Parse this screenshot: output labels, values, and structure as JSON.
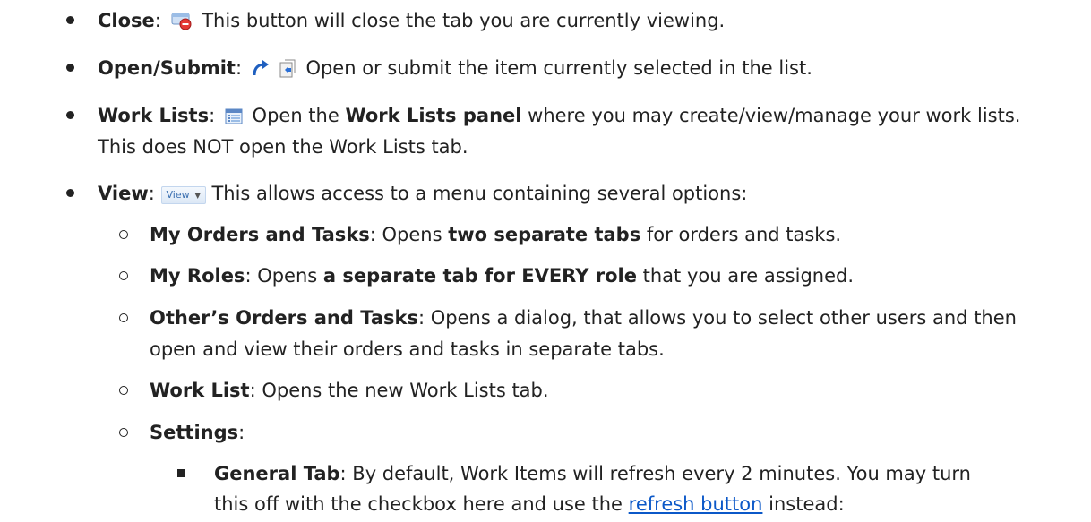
{
  "items": {
    "close": {
      "label": "Close",
      "colon": ":",
      "text": "This button will close the tab you are currently viewing.",
      "icon": "close-tab-icon"
    },
    "open_submit": {
      "label": "Open/Submit",
      "colon": ":",
      "text": "Open or submit the item currently selected in the list.",
      "icons": [
        "open-arrow-icon",
        "submit-document-icon"
      ]
    },
    "work_lists": {
      "label": "Work Lists",
      "colon": ":",
      "text_before": "Open the",
      "bold_phrase": "Work Lists panel",
      "text_after": "where you may create/view/manage your work lists.",
      "line2": "This does NOT open the Work Lists tab.",
      "icon": "work-lists-panel-icon"
    },
    "view": {
      "label": "View",
      "colon": ":",
      "button_label": "View",
      "text": "This allows access to a menu containing several options:",
      "sub": {
        "orders_tasks": {
          "label": "My Orders and Tasks",
          "text_before": ": Opens",
          "bold_phrase": "two separate tabs",
          "text_after": "for orders and tasks."
        },
        "roles": {
          "label": "My Roles",
          "text_before": ": Opens",
          "bold_phrase": "a separate tab for EVERY role",
          "text_after": "that you are assigned."
        },
        "others": {
          "label": "Other’s Orders and Tasks",
          "text": ": Opens a dialog, that allows you to select other users and then",
          "line2": "open and view their orders and tasks in separate tabs."
        },
        "work_list": {
          "label": "Work List",
          "text": ": Opens the new Work Lists tab."
        },
        "settings": {
          "label": "Settings",
          "colon": ":",
          "general": {
            "label": "General Tab",
            "text": ": By default, Work Items will refresh every 2 minutes. You may turn",
            "line2_before": "this off with the checkbox here and use the",
            "link": "refresh button",
            "line2_after": "instead:"
          }
        }
      }
    }
  }
}
